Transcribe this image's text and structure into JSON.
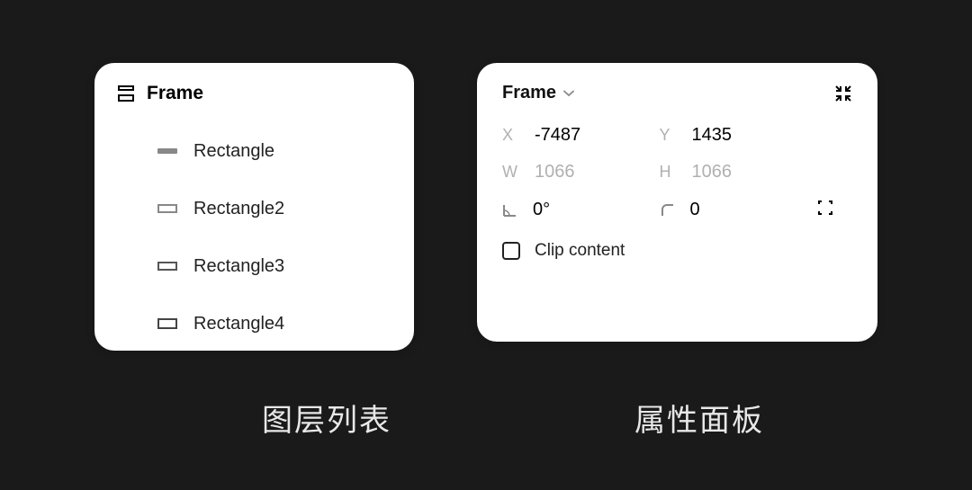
{
  "layers": {
    "title": "Frame",
    "items": [
      {
        "label": "Rectangle"
      },
      {
        "label": "Rectangle2"
      },
      {
        "label": "Rectangle3"
      },
      {
        "label": "Rectangle4"
      }
    ]
  },
  "properties": {
    "title": "Frame",
    "x_label": "X",
    "x_value": "-7487",
    "y_label": "Y",
    "y_value": "1435",
    "w_label": "W",
    "w_value": "1066",
    "h_label": "H",
    "h_value": "1066",
    "rotation_value": "0°",
    "radius_value": "0",
    "clip_label": "Clip content"
  },
  "captions": {
    "left": "图层列表",
    "right": "属性面板"
  }
}
